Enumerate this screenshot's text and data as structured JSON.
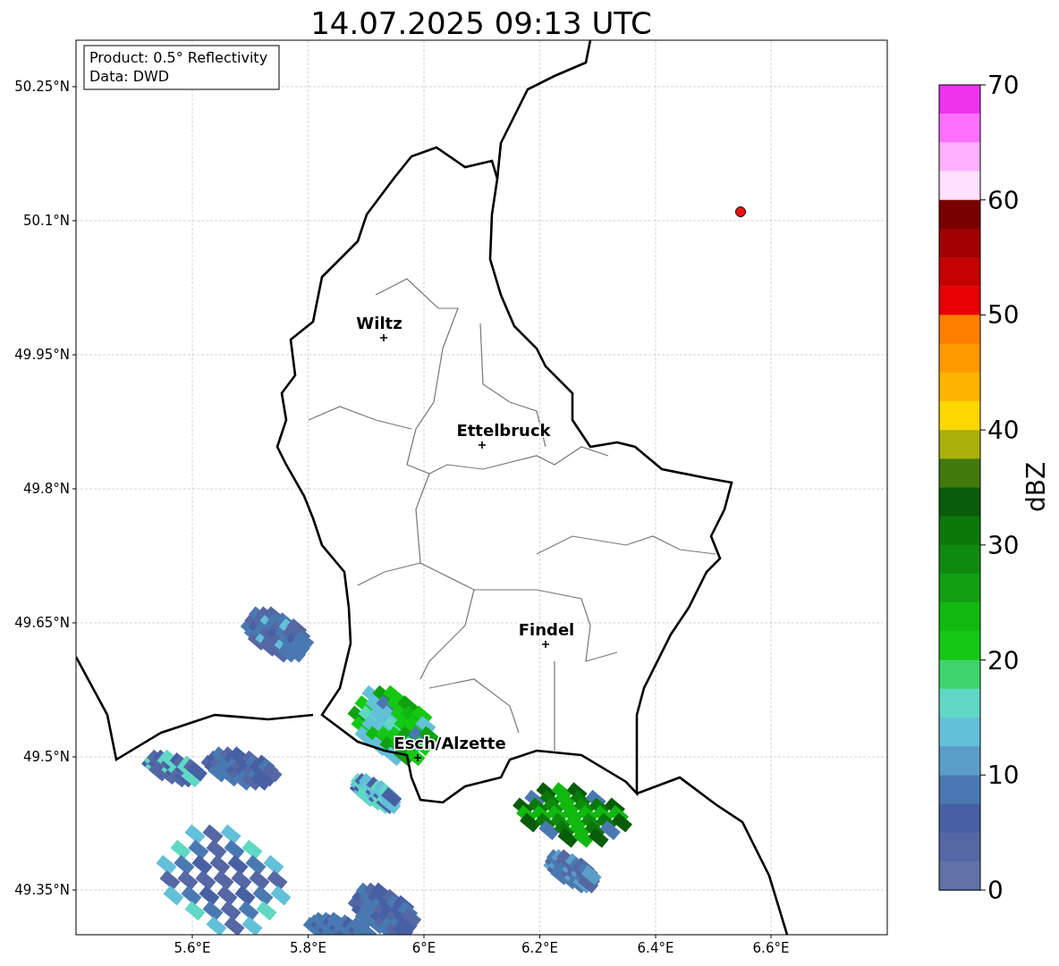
{
  "title": "14.07.2025 09:13 UTC",
  "info_box": [
    "Product: 0.5° Reflectivity",
    "Data: DWD"
  ],
  "map": {
    "lat_ticks": [
      "50.25°N",
      "50.1°N",
      "49.95°N",
      "49.8°N",
      "49.65°N",
      "49.5°N",
      "49.35°N"
    ],
    "lon_ticks": [
      "5.6°E",
      "5.8°E",
      "6°E",
      "6.2°E",
      "6.4°E",
      "6.6°E"
    ],
    "cities": [
      {
        "name": "Wiltz"
      },
      {
        "name": "Ettelbruck"
      },
      {
        "name": "Findel"
      },
      {
        "name": "Esch/Alzette"
      }
    ],
    "marker": {
      "color": "#ee1111"
    }
  },
  "colorbar": {
    "label": "dBZ",
    "ticks": [
      "70",
      "60",
      "50",
      "40",
      "30",
      "20",
      "10",
      "0"
    ],
    "bands": [
      {
        "color": "#ee33ee"
      },
      {
        "color": "#ff70ff"
      },
      {
        "color": "#ffb0ff"
      },
      {
        "color": "#ffe0ff"
      },
      {
        "color": "#7a0000"
      },
      {
        "color": "#a00000"
      },
      {
        "color": "#c40000"
      },
      {
        "color": "#e60000"
      },
      {
        "color": "#ff7f00"
      },
      {
        "color": "#ff9a00"
      },
      {
        "color": "#ffb400"
      },
      {
        "color": "#ffd700"
      },
      {
        "color": "#aab00a"
      },
      {
        "color": "#437a0c"
      },
      {
        "color": "#095c09"
      },
      {
        "color": "#0b780b"
      },
      {
        "color": "#0e8a0e"
      },
      {
        "color": "#10a010"
      },
      {
        "color": "#10b810"
      },
      {
        "color": "#14c814"
      },
      {
        "color": "#3fd46b"
      },
      {
        "color": "#60d8c4"
      },
      {
        "color": "#63c0d9"
      },
      {
        "color": "#5b9ec9"
      },
      {
        "color": "#4a79b1"
      },
      {
        "color": "#4760a4"
      },
      {
        "color": "#5567a4"
      },
      {
        "color": "#6272a8"
      }
    ]
  }
}
